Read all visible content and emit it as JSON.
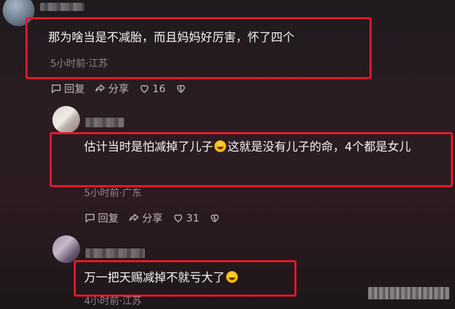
{
  "comments": [
    {
      "text": "那为啥当是不减胎，而且妈妈好厉害，怀了四个",
      "meta": "5小时前·江苏",
      "reply_label": "回复",
      "share_label": "分享",
      "likes": "16"
    },
    {
      "text_before": "估计当时是怕减掉了儿子",
      "text_after": "这就是没有儿子的命，4个都是女儿",
      "meta": "5小时前·广东",
      "reply_label": "回复",
      "share_label": "分享",
      "likes": "31"
    },
    {
      "text": "万一把天赐减掉不就亏大了",
      "meta": "4小时前·江苏"
    }
  ],
  "highlight_color": "#e8182a",
  "icons": [
    "comment-icon",
    "share-icon",
    "heart-icon",
    "broken-heart-icon",
    "laughing-emoji-icon",
    "sweat-smile-emoji-icon"
  ]
}
